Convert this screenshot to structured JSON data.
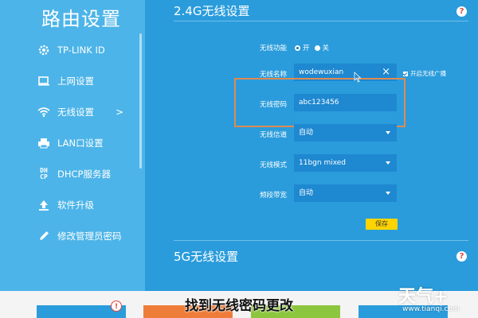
{
  "sidebar": {
    "title": "路由设置",
    "items": [
      {
        "label": "TP-LINK ID",
        "icon": "gear-icon"
      },
      {
        "label": "上网设置",
        "icon": "monitor-icon"
      },
      {
        "label": "无线设置",
        "icon": "wifi-icon",
        "chevron": ">"
      },
      {
        "label": "LAN口设置",
        "icon": "printer-icon"
      },
      {
        "label": "DHCP服务器",
        "icon": "dhcp-icon",
        "glyph_line1": "DH",
        "glyph_line2": "CP"
      },
      {
        "label": "软件升级",
        "icon": "upload-icon"
      },
      {
        "label": "修改管理员密码",
        "icon": "pencil-icon"
      }
    ]
  },
  "wifi24": {
    "title": "2.4G无线设置",
    "help": "?",
    "fields": {
      "function_label": "无线功能",
      "function_on": "开",
      "function_off": "关",
      "ssid_label": "无线名称",
      "ssid_value": "wodewuxian",
      "ssid_clear": "×",
      "broadcast_label": "开启无线广播",
      "password_label": "无线密码",
      "password_value": "abc123456",
      "channel_label": "无线信道",
      "channel_value": "自动",
      "mode_label": "无线模式",
      "mode_value": "11bgn mixed",
      "bandwidth_label": "频段带宽",
      "bandwidth_value": "自动"
    },
    "save_label": "保存"
  },
  "wifi5": {
    "title": "5G无线设置",
    "help": "?"
  },
  "bottom": {
    "alert": "!",
    "caption": "找到无线密码更改",
    "watermark_logo": "天气+",
    "watermark_url": "www.tianqi.com"
  },
  "colors": {
    "sidebar_bg": "#4cb4e8",
    "main_bg": "#2a9cdc",
    "input_bg": "#1e88d0",
    "save_button": "#ffd400",
    "highlight_border": "#e08a52"
  }
}
